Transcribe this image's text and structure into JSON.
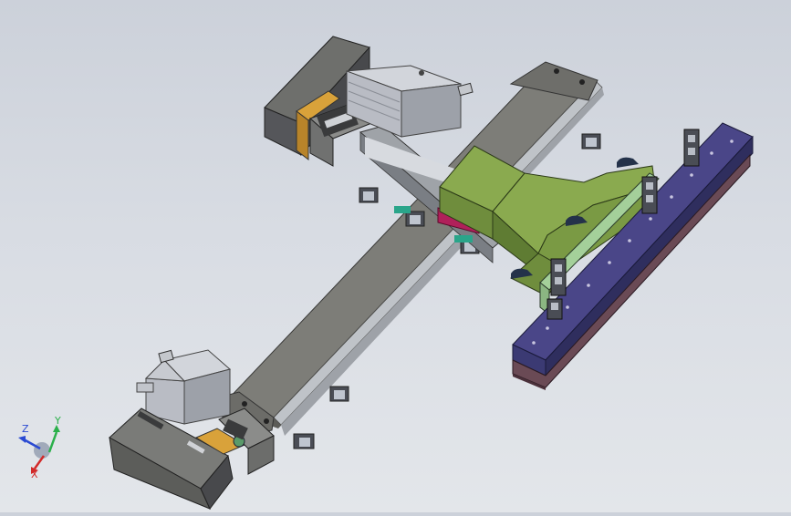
{
  "window": {
    "title": ""
  },
  "viewport": {
    "background_top": "#ccd1da",
    "background_bottom": "#e3e6ea"
  },
  "model": {
    "colors": {
      "rail_body": "#7d7d78",
      "rail_top": "#8e8e88",
      "rail_side": "#5c5c58",
      "carriage": "#7a9a44",
      "carriage_top": "#8aaa4f",
      "carriage_side": "#5f7c33",
      "gripper_beam": "#3b3a73",
      "gripper_beam_top": "#4a4688",
      "gripper_base": "#6a4a55",
      "mount_plate": "#a4d09a",
      "motor": "#b9bcc4",
      "motor_dark": "#8f929a",
      "coupling_plate": "#d9a23a",
      "accent_magenta": "#b0205a",
      "accent_teal": "#2aa58a",
      "clamp": "#24324a"
    }
  },
  "triad": {
    "x_label": "X",
    "y_label": "Y",
    "z_label": "Z",
    "x_color": "#d22a2a",
    "y_color": "#2ab04a",
    "z_color": "#2a4ad2"
  }
}
